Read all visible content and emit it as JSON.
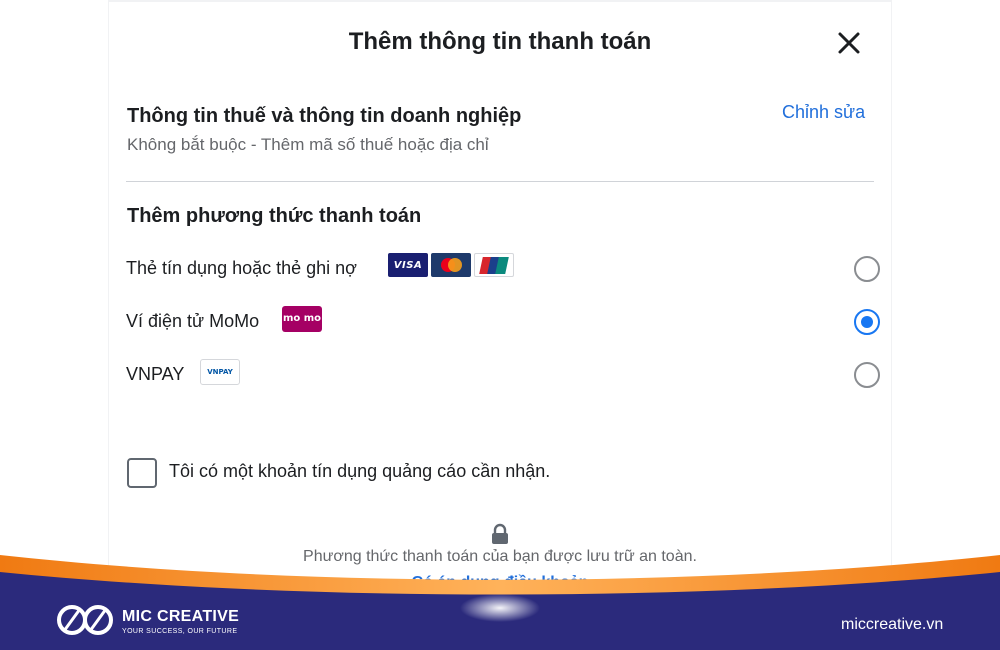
{
  "dialog": {
    "title": "Thêm thông tin thanh toán",
    "close_icon": "close-icon"
  },
  "tax_section": {
    "title": "Thông tin thuế và thông tin doanh nghiệp",
    "subtitle": "Không bắt buộc - Thêm mã số thuế hoặc địa chỉ",
    "edit_label": "Chỉnh sửa"
  },
  "payment_section": {
    "title": "Thêm phương thức thanh toán",
    "methods": [
      {
        "label": "Thẻ tín dụng hoặc thẻ ghi nợ",
        "logos": [
          "VISA",
          "mastercard-logo",
          "unionpay-logo"
        ],
        "selected": false
      },
      {
        "label": "Ví điện tử MoMo",
        "logos": [
          "mo mo"
        ],
        "selected": true
      },
      {
        "label": "VNPAY",
        "logos": [
          "VNPAY"
        ],
        "selected": false
      }
    ]
  },
  "credit_checkbox": {
    "label": "Tôi có một khoản tín dụng quảng cáo cần nhận.",
    "checked": false
  },
  "footer": {
    "lock_icon": "lock-icon",
    "secure_text": "Phương thức thanh toán của bạn được lưu trữ an toàn.",
    "terms_link": "Có áp dụng điều khoản"
  },
  "banner": {
    "brand_name": "MIC CREATIVE",
    "tagline": "YOUR SUCCESS, OUR FUTURE",
    "website": "miccreative.vn",
    "colors": {
      "navy": "#2b2a7c",
      "orange": "#f07a12",
      "accent": "#1877f2"
    }
  }
}
